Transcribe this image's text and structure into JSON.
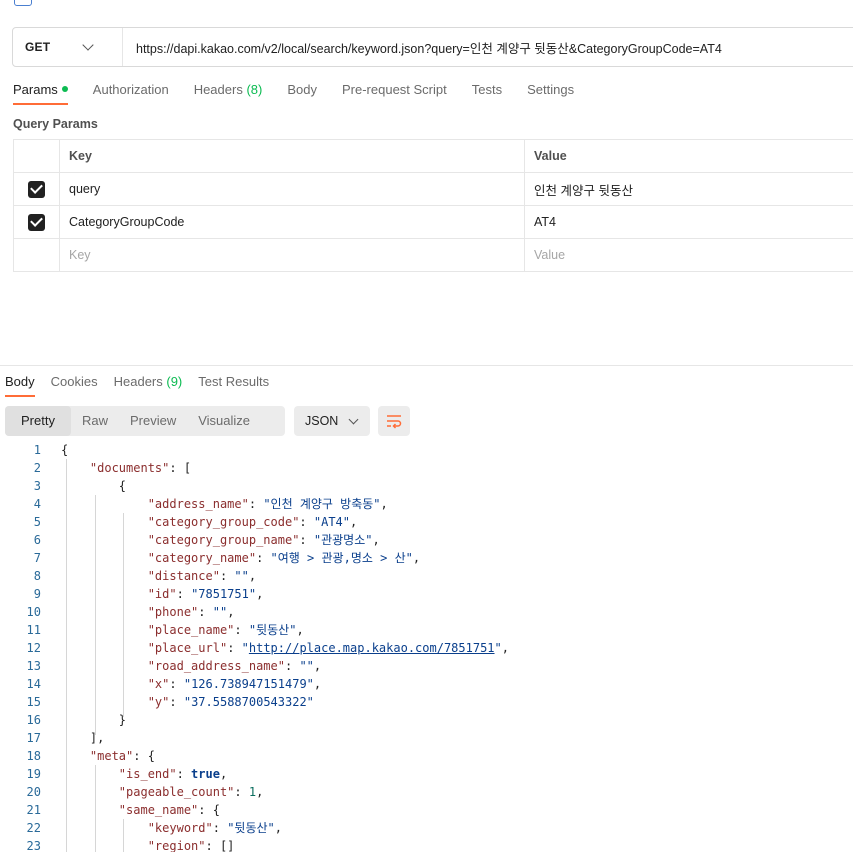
{
  "colors": {
    "accent": "#ff6c37",
    "active_dot": "#0cbb52",
    "json_key": "#8b2e2e",
    "json_string": "#0a3f8c",
    "json_number": "#0a6d5e"
  },
  "request": {
    "method": "GET",
    "url": "https://dapi.kakao.com/v2/local/search/keyword.json?query=인천 계양구 뒷동산&CategoryGroupCode=AT4"
  },
  "request_tabs": {
    "params": "Params",
    "authorization": "Authorization",
    "headers": "Headers",
    "headers_count": "(8)",
    "body": "Body",
    "prerequest": "Pre-request Script",
    "tests": "Tests",
    "settings": "Settings"
  },
  "query_params": {
    "title": "Query Params",
    "col_key": "Key",
    "col_value": "Value",
    "rows": [
      {
        "key": "query",
        "value": "인천 계양구 뒷동산"
      },
      {
        "key": "CategoryGroupCode",
        "value": "AT4"
      }
    ],
    "placeholder_key": "Key",
    "placeholder_value": "Value"
  },
  "response_tabs": {
    "body": "Body",
    "cookies": "Cookies",
    "headers": "Headers",
    "headers_count": "(9)",
    "test_results": "Test Results"
  },
  "view_modes": {
    "pretty": "Pretty",
    "raw": "Raw",
    "preview": "Preview",
    "visualize": "Visualize",
    "format": "JSON"
  },
  "code": {
    "l1_brace": "{",
    "k_documents": "\"documents\"",
    "open_bracket": "[",
    "l3_brace": "{",
    "pairs": [
      {
        "k": "\"address_name\"",
        "v": "\"인천 계양구 방축동\""
      },
      {
        "k": "\"category_group_code\"",
        "v": "\"AT4\""
      },
      {
        "k": "\"category_group_name\"",
        "v": "\"관광명소\""
      },
      {
        "k": "\"category_name\"",
        "v": "\"여행 > 관광,명소 > 산\""
      },
      {
        "k": "\"distance\"",
        "v": "\"\""
      },
      {
        "k": "\"id\"",
        "v": "\"7851751\""
      },
      {
        "k": "\"phone\"",
        "v": "\"\""
      },
      {
        "k": "\"place_name\"",
        "v": "\"뒷동산\""
      },
      {
        "k": "\"place_url\"",
        "v": "http://place.map.kakao.com/7851751"
      },
      {
        "k": "\"road_address_name\"",
        "v": "\"\""
      },
      {
        "k": "\"x\"",
        "v": "\"126.738947151479\""
      },
      {
        "k": "\"y\"",
        "v": "\"37.5588700543322\""
      }
    ],
    "close_brace": "}",
    "close_bracket": "],",
    "k_meta": "\"meta\"",
    "k_is_end": "\"is_end\"",
    "v_is_end": "true",
    "k_pageable_count": "\"pageable_count\"",
    "v_pageable_count": "1",
    "k_same_name": "\"same_name\"",
    "k_keyword": "\"keyword\"",
    "v_keyword": "\"뒷동산\"",
    "k_region": "\"region\"",
    "v_region": "[]"
  }
}
